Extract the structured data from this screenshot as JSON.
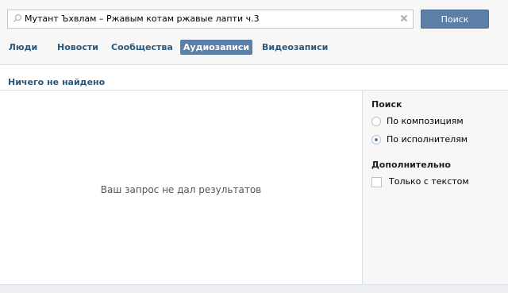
{
  "search": {
    "query": "Мутант Ъхвлам – Ржавым котам ржавые лапти ч.3",
    "button_label": "Поиск"
  },
  "tabs": [
    {
      "label": "Люди",
      "active": false
    },
    {
      "label": "Новости",
      "active": false
    },
    {
      "label": "Сообщества",
      "active": false
    },
    {
      "label": "Аудиозаписи",
      "active": true
    },
    {
      "label": "Видеозаписи",
      "active": false
    }
  ],
  "status": {
    "text": "Ничего не найдено"
  },
  "results": {
    "empty_text": "Ваш запрос не дал результатов"
  },
  "filters": {
    "search_heading": "Поиск",
    "search_options": [
      {
        "label": "По композициям",
        "checked": false
      },
      {
        "label": "По исполнителям",
        "checked": true
      }
    ],
    "extra_heading": "Дополнительно",
    "extra_options": [
      {
        "label": "Только с текстом",
        "checked": false
      }
    ]
  },
  "icons": {
    "search": "search-icon",
    "clear": "close-icon"
  },
  "colors": {
    "accent": "#5b7fa6",
    "link": "#2b587a",
    "background": "#edeef0"
  }
}
